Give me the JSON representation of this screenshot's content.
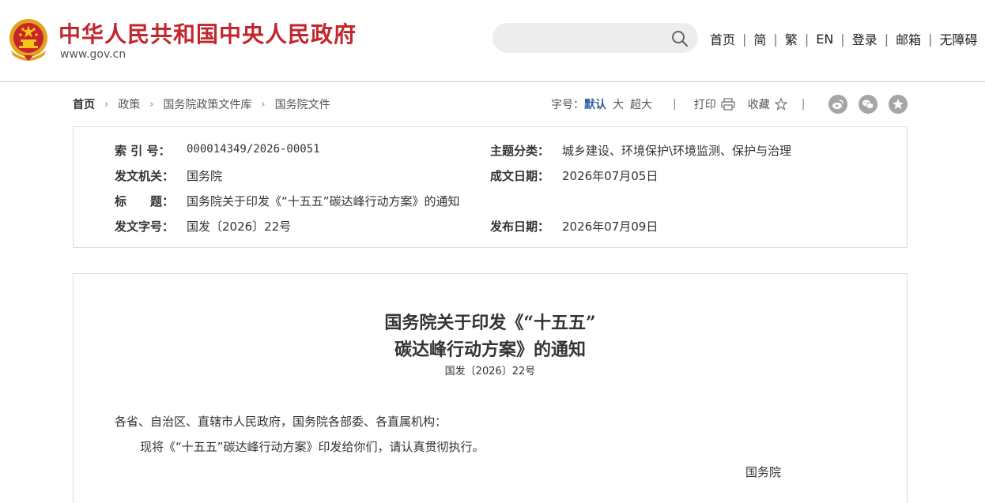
{
  "header": {
    "site_title": "中华人民共和国中央人民政府",
    "site_url": "www.gov.cn",
    "search_placeholder": "",
    "nav": [
      "首页",
      "简",
      "繁",
      "EN",
      "登录",
      "邮箱",
      "无障碍"
    ]
  },
  "breadcrumb": [
    "首页",
    "政策",
    "国务院政策文件库",
    "国务院文件"
  ],
  "tools": {
    "font_label": "字号：",
    "font_sizes": [
      "默认",
      "大",
      "超大"
    ],
    "print": "打印",
    "favorite": "收藏"
  },
  "share_icons": [
    "weibo-icon",
    "wechat-icon",
    "qzone-star-icon"
  ],
  "info": {
    "index_label": "索 引 号：",
    "index_value": "000014349/2026-00051",
    "subject_label": "主题分类：",
    "subject_value": "城乡建设、环境保护\\环境监测、保护与治理",
    "issuer_label": "发文机关：",
    "issuer_value": "国务院",
    "written_label": "成文日期：",
    "written_value": "2026年07月05日",
    "title_label": "标　　题：",
    "title_value": "国务院关于印发《“十五五”碳达峰行动方案》的通知",
    "docno_label": "发文字号：",
    "docno_value": "国发〔2026〕22号",
    "published_label": "发布日期：",
    "published_value": "2026年07月09日"
  },
  "article": {
    "title_line1": "国务院关于印发《“十五五”",
    "title_line2": "碳达峰行动方案》的通知",
    "doc_number": "国发〔2026〕22号",
    "salutation": "各省、自治区、直辖市人民政府，国务院各部委、各直属机构：",
    "body": "现将《“十五五”碳达峰行动方案》印发给你们，请认真贯彻执行。",
    "signature": "国务院"
  },
  "colors": {
    "brand_red": "#c1272d",
    "active_blue": "#2f5f9e",
    "share_gray": "#a5a5a5"
  }
}
